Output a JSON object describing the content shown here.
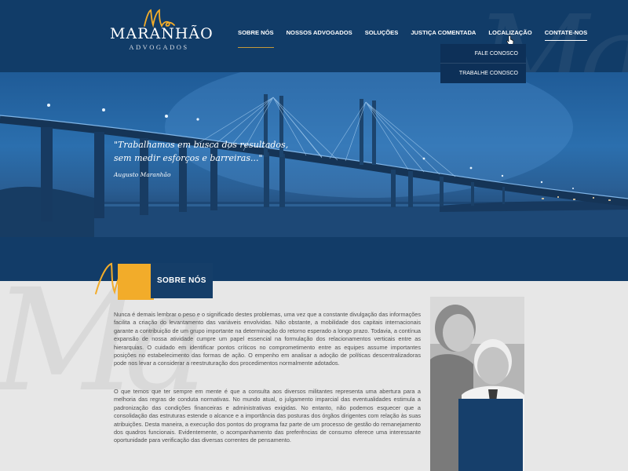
{
  "brand": {
    "name": "MARANHÃO",
    "subtitle": "ADVOGADOS",
    "mark": "Ma",
    "gold": "#f2ac2a",
    "navy": "#123c68"
  },
  "nav": {
    "items": [
      {
        "label": "SOBRE NÓS",
        "state": "active"
      },
      {
        "label": "NOSSOS ADVOGADOS",
        "state": ""
      },
      {
        "label": "SOLUÇÕES",
        "state": ""
      },
      {
        "label": "JUSTIÇA COMENTADA",
        "state": ""
      },
      {
        "label": "LOCALIZAÇÃO",
        "state": ""
      },
      {
        "label": "CONTATE-NOS",
        "state": "hover"
      }
    ],
    "dropdown": [
      "FALE CONOSCO",
      "TRABALHE CONOSCO"
    ]
  },
  "hero": {
    "quote_line1": "\"Trabalhamos em busca dos resultados,",
    "quote_line2": "sem medir esforços e barreiras...\"",
    "author": "Augusto Maranhão"
  },
  "section": {
    "title": "SOBRE NÓS",
    "paragraph1": "Nunca é demais lembrar o peso e o significado destes problemas, uma vez que a constante divulgação das informações facilita a criação do levantamento das variáveis envolvidas. Não obstante, a mobilidade dos capitais internacionais garante a contribuição de um grupo importante na determinação do retorno esperado a longo prazo. Todavia, a contínua expansão de nossa atividade cumpre um papel essencial na formulação dos relacionamentos verticais entre as hierarquias. O cuidado em identificar pontos críticos no comprometimento entre as equipes assume importantes posições no estabelecimento das formas de ação. O empenho em analisar a adoção de políticas descentralizadoras pode nos levar a considerar a reestruturação dos procedimentos normalmente adotados.",
    "paragraph2": "O que temos que ter sempre em mente é que a consulta aos diversos militantes representa uma abertura para a melhoria das regras de conduta normativas. No mundo atual, o julgamento imparcial das eventualidades estimula a padronização das condições financeiras e administrativas exigidas. No entanto, não podemos esquecer que a consolidação das estruturas estende o alcance e a importância das posturas dos órgãos dirigentes com relação às suas atribuições. Desta maneira, a execução dos pontos do programa faz parte de um processo de gestão do remanejamento dos quadros funcionais. Evidentemente, o acompanhamento das preferências de consumo oferece uma interessante oportunidade para verificação das diversas correntes de pensamento."
  },
  "icons": {
    "cursor": "hand-pointer-icon"
  }
}
